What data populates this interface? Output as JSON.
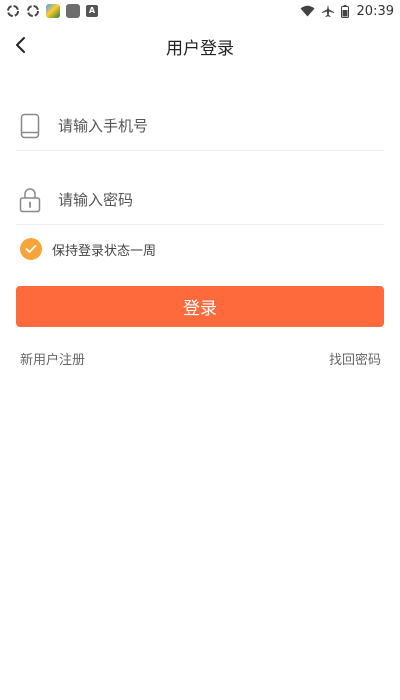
{
  "status_bar": {
    "time": "20:39",
    "left_icons": [
      "sync-icon",
      "sync-icon",
      "game-app-icon",
      "app-icon",
      "a-badge-icon"
    ],
    "app_a_letter": "A",
    "right_icons": [
      "wifi-icon",
      "airplane-icon",
      "battery-icon"
    ]
  },
  "header": {
    "title": "用户登录",
    "back_icon": "chevron-left-icon"
  },
  "form": {
    "phone": {
      "icon": "phone-icon",
      "placeholder": "请输入手机号",
      "value": ""
    },
    "password": {
      "icon": "lock-icon",
      "placeholder": "请输入密码",
      "value": ""
    },
    "keep_login": {
      "label": "保持登录状态一周",
      "checked": true,
      "icon": "check-circle-icon"
    },
    "submit_label": "登录"
  },
  "links": {
    "register": "新用户注册",
    "forgot_password": "找回密码"
  },
  "colors": {
    "accent": "#ff6a3d",
    "checkbox": "#f7a43b"
  }
}
